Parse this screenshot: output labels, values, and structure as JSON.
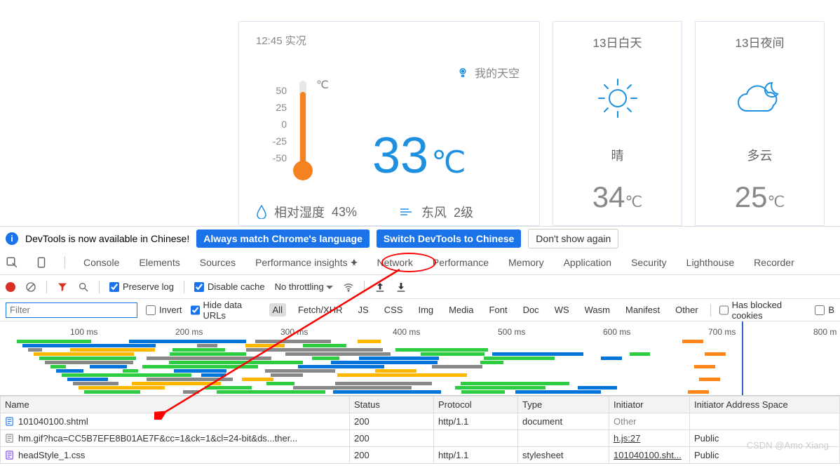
{
  "weather": {
    "timeLabel": "12:45 实况",
    "skyLabel": "我的天空",
    "celsius": "℃",
    "scale": [
      "50",
      "25",
      "0",
      "-25",
      "-50"
    ],
    "bigTemp": "33",
    "bigUnit": "℃",
    "humidityLabel": "相对湿度",
    "humidityValue": "43%",
    "windLabel": "东风",
    "windLevel": "2级",
    "day": {
      "title": "13日白天",
      "cond": "晴",
      "temp": "34",
      "unit": "℃"
    },
    "night": {
      "title": "13日夜间",
      "cond": "多云",
      "temp": "25",
      "unit": "℃"
    }
  },
  "notice": {
    "text": "DevTools is now available in Chinese!",
    "btn1": "Always match Chrome's language",
    "btn2": "Switch DevTools to Chinese",
    "btn3": "Don't show again"
  },
  "tabs": [
    "Console",
    "Elements",
    "Sources",
    "Performance insights",
    "Network",
    "Performance",
    "Memory",
    "Application",
    "Security",
    "Lighthouse",
    "Recorder"
  ],
  "toolbar": {
    "preserve": "Preserve log",
    "disable": "Disable cache",
    "throttle": "No throttling"
  },
  "filterRow": {
    "placeholder": "Filter",
    "invert": "Invert",
    "hide": "Hide data URLs",
    "pills": [
      "All",
      "Fetch/XHR",
      "JS",
      "CSS",
      "Img",
      "Media",
      "Font",
      "Doc",
      "WS",
      "Wasm",
      "Manifest",
      "Other"
    ],
    "blocked": "Has blocked cookies",
    "last": "B"
  },
  "waterfall": {
    "times": [
      "100 ms",
      "200 ms",
      "300 ms",
      "400 ms",
      "500 ms",
      "600 ms",
      "700 ms",
      "800 m"
    ]
  },
  "table": {
    "headers": [
      "Name",
      "Status",
      "Protocol",
      "Type",
      "Initiator",
      "Initiator Address Space"
    ],
    "rows": [
      {
        "name": "101040100.shtml",
        "status": "200",
        "protocol": "http/1.1",
        "type": "document",
        "initiator": "Other",
        "space": "",
        "icon": "doc",
        "initLink": false
      },
      {
        "name": "hm.gif?hca=CC5B7EFE8B01AE7F&cc=1&ck=1&cl=24-bit&ds...ther...",
        "status": "200",
        "protocol": "",
        "type": "",
        "initiator": "h.js:27",
        "space": "Public",
        "icon": "img",
        "initLink": true
      },
      {
        "name": "headStyle_1.css",
        "status": "200",
        "protocol": "http/1.1",
        "type": "stylesheet",
        "initiator": "101040100.sht...",
        "space": "Public",
        "icon": "css",
        "initLink": true
      }
    ]
  },
  "watermark": "CSDN @Amo Xiang"
}
